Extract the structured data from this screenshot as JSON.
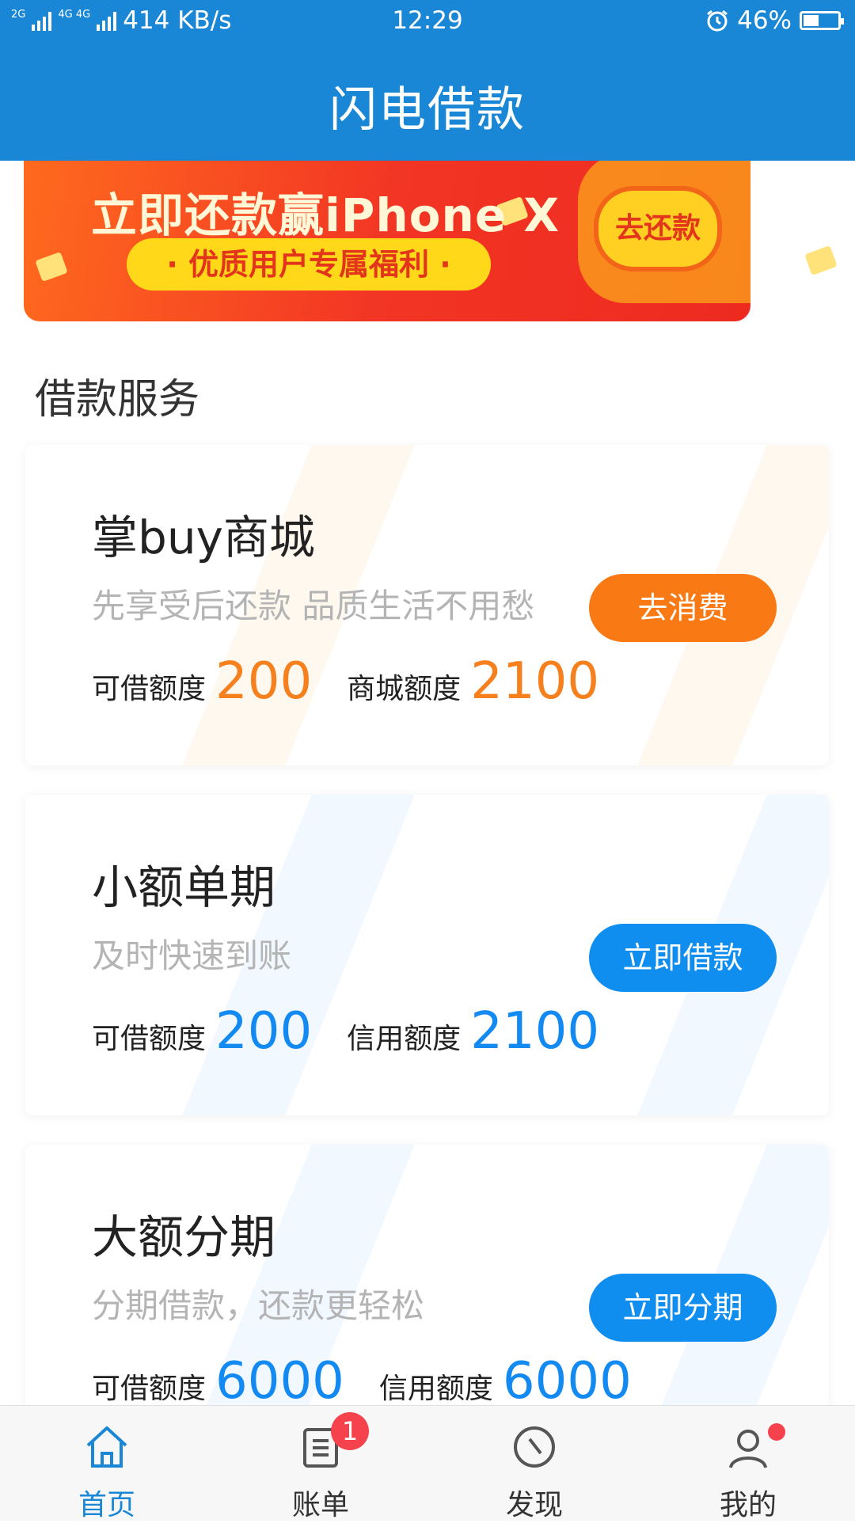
{
  "status": {
    "net1": "2G",
    "net2": "4G 4G",
    "speed": "414 KB/s",
    "time": "12:29",
    "battery": "46%",
    "battery_level": 0.46
  },
  "app": {
    "title": "闪电借款"
  },
  "banner": {
    "headline": "立即还款赢iPhone X",
    "subline": "· 优质用户专属福利 ·",
    "cta": "去还款"
  },
  "section": {
    "title": "借款服务"
  },
  "cards": [
    {
      "title": "掌buy商城",
      "subtitle": "先享受后还款 品质生活不用愁",
      "label1": "可借额度",
      "value1": "200",
      "label2": "商城额度",
      "value2": "2100",
      "button": "去消费"
    },
    {
      "title": "小额单期",
      "subtitle": "及时快速到账",
      "label1": "可借额度",
      "value1": "200",
      "label2": "信用额度",
      "value2": "2100",
      "button": "立即借款"
    },
    {
      "title": "大额分期",
      "subtitle": "分期借款，还款更轻松",
      "label1": "可借额度",
      "value1": "6000",
      "label2": "信用额度",
      "value2": "6000",
      "button": "立即分期"
    }
  ],
  "tabs": [
    {
      "label": "首页",
      "icon": "home-icon",
      "active": true
    },
    {
      "label": "账单",
      "icon": "bill-icon",
      "badge": "1"
    },
    {
      "label": "发现",
      "icon": "compass-icon"
    },
    {
      "label": "我的",
      "icon": "user-icon",
      "dot": true
    }
  ],
  "colors": {
    "header": "#1a87d6",
    "orange": "#f97a14",
    "blue": "#0f8ef0",
    "badge": "#f5424d"
  }
}
